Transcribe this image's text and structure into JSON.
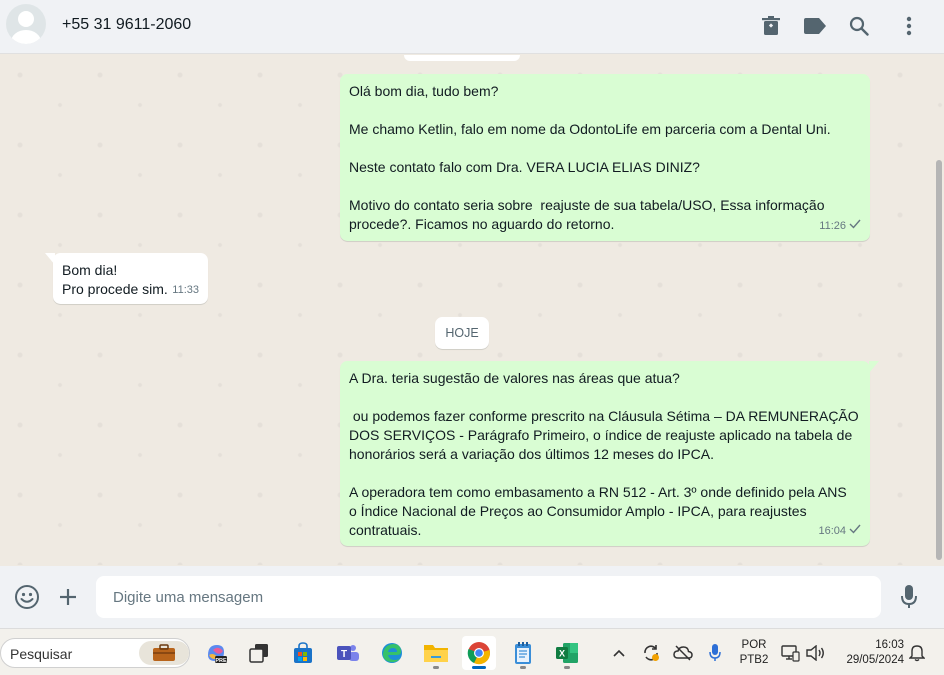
{
  "header": {
    "contact_name": "+55 31 9611-2060",
    "icons": [
      "trash-icon",
      "label-icon",
      "search-icon",
      "menu-dots-icon"
    ]
  },
  "messages": [
    {
      "direction": "out",
      "lines": [
        "Olá bom dia, tudo bem?",
        "",
        "Me chamo Ketlin, falo em nome da OdontoLife em parceria com a Dental Uni.",
        "",
        "Neste contato falo com Dra. VERA LUCIA ELIAS DINIZ?",
        "",
        "Motivo do contato seria sobre  reajuste de sua tabela/USO, Essa informação",
        "procede?. Ficamos no aguardo do retorno."
      ],
      "time": "11:26",
      "status": "sent"
    },
    {
      "direction": "in",
      "lines": [
        "Bom dia!",
        "Pro procede sim."
      ],
      "time": "11:33"
    },
    {
      "direction": "out",
      "lines": [
        "A Dra. teria sugestão de valores nas áreas que atua?",
        "",
        " ou podemos fazer conforme prescrito na Cláusula Sétima – DA REMUNERAÇÃO",
        "DOS SERVIÇOS - Parágrafo Primeiro, o índice de reajuste aplicado na tabela de",
        "honorários será a variação dos últimos 12 meses do IPCA.",
        "",
        "A operadora tem como embasamento a RN 512 - Art. 3º onde definido pela ANS",
        "o Índice Nacional de Preços ao Consumidor Amplo - IPCA, para reajustes",
        "contratuais."
      ],
      "time": "16:04",
      "status": "sent"
    }
  ],
  "day_separator": "HOJE",
  "composer": {
    "placeholder": "Digite uma mensagem"
  },
  "taskbar": {
    "search_label": "Pesquisar",
    "apps": [
      "copilot-icon",
      "task-view-icon",
      "store-icon",
      "teams-icon",
      "edge-icon",
      "file-explorer-icon",
      "chrome-icon",
      "notepad-icon",
      "excel-icon"
    ],
    "active_app": "chrome-icon",
    "lang_top": "POR",
    "lang_bottom": "PTB2",
    "time": "16:03",
    "date": "29/05/2024"
  },
  "colors": {
    "outgoing_bubble": "#d9fdd3",
    "incoming_bubble": "#ffffff",
    "chat_bg": "#efeae2",
    "header_bg": "#f0f2f5"
  }
}
